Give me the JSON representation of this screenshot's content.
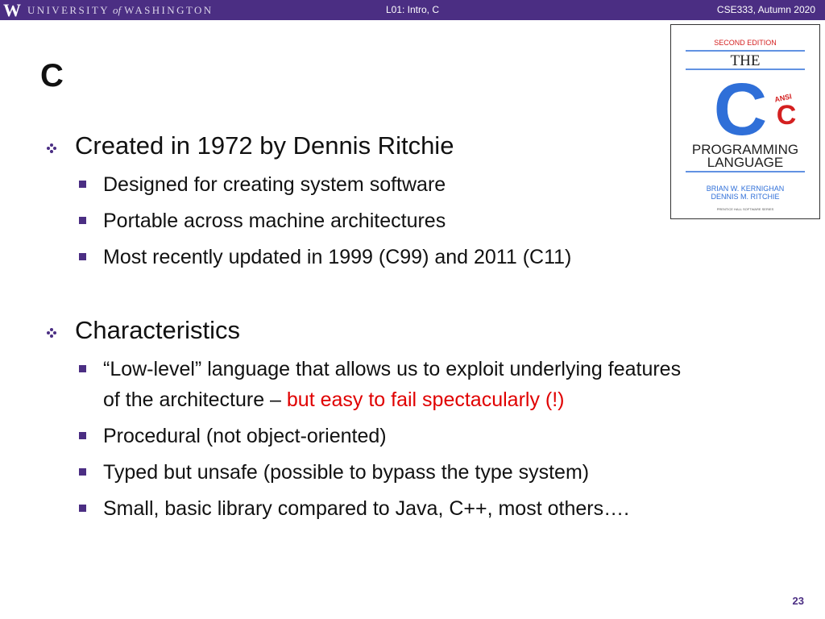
{
  "header": {
    "logo_letter": "W",
    "university_part1": "UNIVERSITY",
    "university_of": "of",
    "university_part2": "WASHINGTON",
    "lecture": "L01:  Intro, C",
    "course": "CSE333, Autumn 2020"
  },
  "slide": {
    "title": "C",
    "page_number": "23"
  },
  "book_cover": {
    "edition": "SECOND EDITION",
    "the": "THE",
    "big_c": "C",
    "ansi": "ANSI",
    "ansi_c": "C",
    "programming": "PROGRAMMING",
    "language": "LANGUAGE",
    "author1": "BRIAN W. KERNIGHAN",
    "author2": "DENNIS M. RITCHIE",
    "publisher": "PRENTICE HALL SOFTWARE SERIES"
  },
  "bullets": [
    {
      "text": "Created in 1972 by Dennis Ritchie",
      "sub": [
        "Designed for creating system software",
        "Portable across machine architectures",
        "Most recently updated in 1999 (C99) and 2011 (C11)"
      ]
    },
    {
      "text": "Characteristics",
      "sub_lowlevel_line1": "“Low-level” language that allows us to exploit underlying features",
      "sub_lowlevel_line2_plain": "of the architecture – ",
      "sub_lowlevel_line2_red": "but easy to fail spectacularly (!)",
      "sub": [
        "Procedural (not object-oriented)",
        "Typed but unsafe (possible to bypass the type system)",
        "Small, basic library compared to Java, C++, most others…."
      ]
    }
  ],
  "colors": {
    "header_bg": "#4b2e83",
    "bullet_square": "#4b2e83",
    "emphasis_red": "#e00000",
    "book_blue": "#2f6fd8",
    "book_red": "#d42020"
  }
}
